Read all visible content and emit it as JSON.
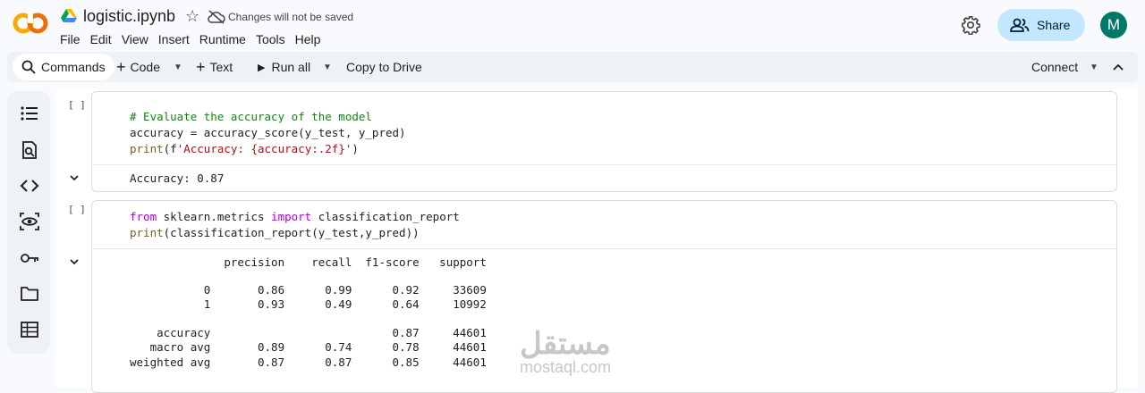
{
  "header": {
    "title": "logistic.ipynb",
    "save_status": "Changes will not be saved",
    "menu": [
      "File",
      "Edit",
      "View",
      "Insert",
      "Runtime",
      "Tools",
      "Help"
    ],
    "share_label": "Share",
    "avatar_letter": "M"
  },
  "toolbar": {
    "commands": "Commands",
    "code": "Code",
    "text": "Text",
    "run_all": "Run all",
    "copy_to_drive": "Copy to Drive",
    "connect": "Connect"
  },
  "sidebar": {
    "icons": [
      "table-of-contents-icon",
      "find-icon",
      "code-snippets-icon",
      "variables-icon",
      "secrets-key-icon",
      "files-folder-icon",
      "data-table-icon"
    ]
  },
  "cells": [
    {
      "bracket": "[ ]",
      "code": {
        "comment": "# Evaluate the accuracy of the model",
        "line2": "accuracy = accuracy_score(y_test, y_pred)",
        "line3_fn": "print",
        "line3_open": "(f",
        "line3_str": "'Accuracy: {accuracy:.2f}'",
        "line3_close": ")"
      },
      "output": [
        "Accuracy: 0.87"
      ]
    },
    {
      "bracket": "[ ]",
      "code": {
        "kw_from": "from",
        "module": " sklearn.metrics ",
        "kw_import": "import",
        "name": " classification_report",
        "line2_fn": "print",
        "line2_rest": "(classification_report(y_test,y_pred))"
      },
      "output": [
        "              precision    recall  f1-score   support",
        "",
        "           0       0.86      0.99      0.92     33609",
        "           1       0.93      0.49      0.64     10992",
        "",
        "    accuracy                           0.87     44601",
        "   macro avg       0.89      0.74      0.78     44601",
        "weighted avg       0.87      0.87      0.85     44601"
      ]
    }
  ],
  "watermark": {
    "arabic": "مستقل",
    "latin": "mostaql.com"
  }
}
